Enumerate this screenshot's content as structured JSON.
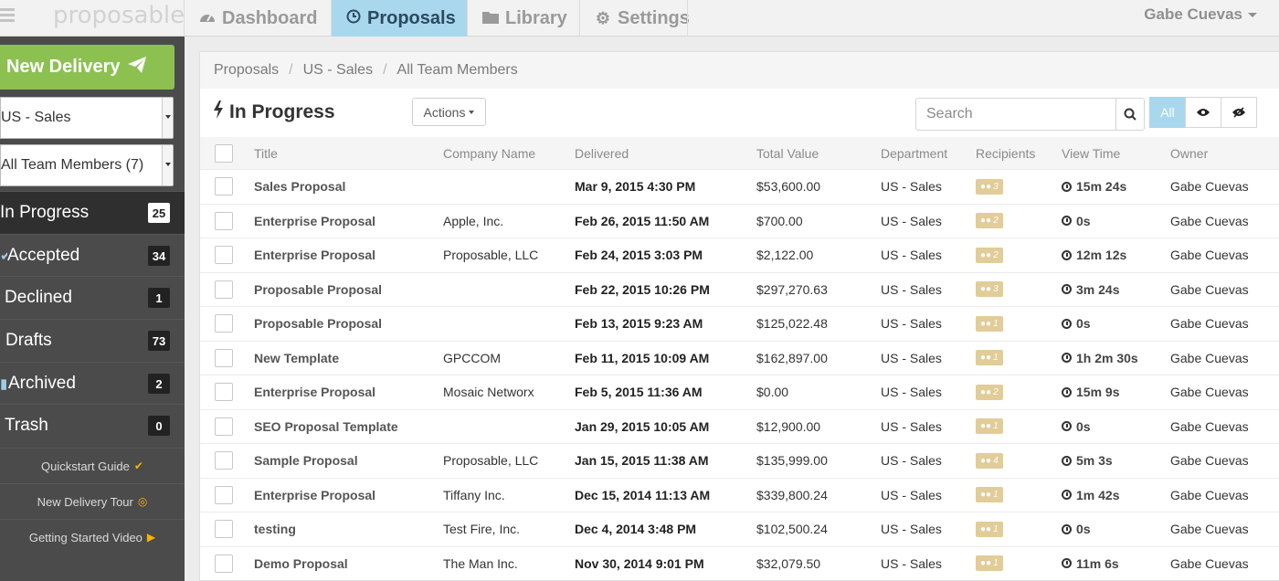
{
  "topbar": {
    "logo": "proposable",
    "tabs": [
      {
        "label": "Dashboard",
        "icon": "dashboard-icon"
      },
      {
        "label": "Proposals",
        "icon": "clock-icon"
      },
      {
        "label": "Library",
        "icon": "folder-icon"
      },
      {
        "label": "Settings",
        "icon": "gear-icon"
      }
    ],
    "user": "Gabe Cuevas",
    "accent": "#a9d7ee"
  },
  "sidebar": {
    "new_delivery": "New Delivery",
    "team_select": "US - Sales",
    "member_select": "All Team Members (7)",
    "items": [
      {
        "label": "In Progress",
        "count": "25"
      },
      {
        "label": "Accepted",
        "count": "34"
      },
      {
        "label": "Declined",
        "count": "1"
      },
      {
        "label": "Drafts",
        "count": "73"
      },
      {
        "label": "Archived",
        "count": "2"
      },
      {
        "label": "Trash",
        "count": "0"
      }
    ],
    "links": [
      {
        "label": "Quickstart Guide"
      },
      {
        "label": "New Delivery Tour"
      },
      {
        "label": "Getting Started Video"
      }
    ],
    "button_color": "#8cc152"
  },
  "main": {
    "breadcrumb": [
      "Proposals",
      "US - Sales",
      "All Team Members"
    ],
    "title": "In Progress",
    "actions_label": "Actions",
    "search": {
      "placeholder": "Search",
      "value": ""
    },
    "filters": [
      {
        "label": "All"
      }
    ],
    "columns": [
      "Title",
      "Company Name",
      "Delivered",
      "Total Value",
      "Department",
      "Recipients",
      "View Time",
      "Owner"
    ],
    "rows": [
      {
        "title": "Sales Proposal",
        "company": "",
        "delivered": "Mar 9, 2015 4:30 PM",
        "value": "$53,600.00",
        "dept": "US - Sales",
        "recipients": "3",
        "view": "15m 24s",
        "owner": "Gabe Cuevas"
      },
      {
        "title": "Enterprise Proposal",
        "company": "Apple, Inc.",
        "delivered": "Feb 26, 2015 11:50 AM",
        "value": "$700.00",
        "dept": "US - Sales",
        "recipients": "2",
        "view": "0s",
        "owner": "Gabe Cuevas"
      },
      {
        "title": "Enterprise Proposal",
        "company": "Proposable, LLC",
        "delivered": "Feb 24, 2015 3:03 PM",
        "value": "$2,122.00",
        "dept": "US - Sales",
        "recipients": "2",
        "view": "12m 12s",
        "owner": "Gabe Cuevas"
      },
      {
        "title": "Proposable Proposal",
        "company": "",
        "delivered": "Feb 22, 2015 10:26 PM",
        "value": "$297,270.63",
        "dept": "US - Sales",
        "recipients": "3",
        "view": "3m 24s",
        "owner": "Gabe Cuevas"
      },
      {
        "title": "Proposable Proposal",
        "company": "",
        "delivered": "Feb 13, 2015 9:23 AM",
        "value": "$125,022.48",
        "dept": "US - Sales",
        "recipients": "1",
        "view": "0s",
        "owner": "Gabe Cuevas"
      },
      {
        "title": "New Template",
        "company": "GPCCOM",
        "delivered": "Feb 11, 2015 10:09 AM",
        "value": "$162,897.00",
        "dept": "US - Sales",
        "recipients": "1",
        "view": "1h 2m 30s",
        "owner": "Gabe Cuevas"
      },
      {
        "title": "Enterprise Proposal",
        "company": "Mosaic Networx",
        "delivered": "Feb 5, 2015 11:36 AM",
        "value": "$0.00",
        "dept": "US - Sales",
        "recipients": "2",
        "view": "15m 9s",
        "owner": "Gabe Cuevas"
      },
      {
        "title": "SEO Proposal Template",
        "company": "",
        "delivered": "Jan 29, 2015 10:05 AM",
        "value": "$12,900.00",
        "dept": "US - Sales",
        "recipients": "1",
        "view": "0s",
        "owner": "Gabe Cuevas"
      },
      {
        "title": "Sample Proposal",
        "company": "Proposable, LLC",
        "delivered": "Jan 15, 2015 11:38 AM",
        "value": "$135,999.00",
        "dept": "US - Sales",
        "recipients": "4",
        "view": "5m 3s",
        "owner": "Gabe Cuevas"
      },
      {
        "title": "Enterprise Proposal",
        "company": "Tiffany Inc.",
        "delivered": "Dec 15, 2014 11:13 AM",
        "value": "$339,800.24",
        "dept": "US - Sales",
        "recipients": "1",
        "view": "1m 42s",
        "owner": "Gabe Cuevas"
      },
      {
        "title": "testing",
        "company": "Test Fire, Inc.",
        "delivered": "Dec 4, 2014 3:48 PM",
        "value": "$102,500.24",
        "dept": "US - Sales",
        "recipients": "1",
        "view": "0s",
        "owner": "Gabe Cuevas"
      },
      {
        "title": "Demo Proposal",
        "company": "The Man Inc.",
        "delivered": "Nov 30, 2014 9:01 PM",
        "value": "$32,079.50",
        "dept": "US - Sales",
        "recipients": "1",
        "view": "11m 6s",
        "owner": "Gabe Cuevas"
      }
    ],
    "badge_color": "#e2cc98"
  }
}
